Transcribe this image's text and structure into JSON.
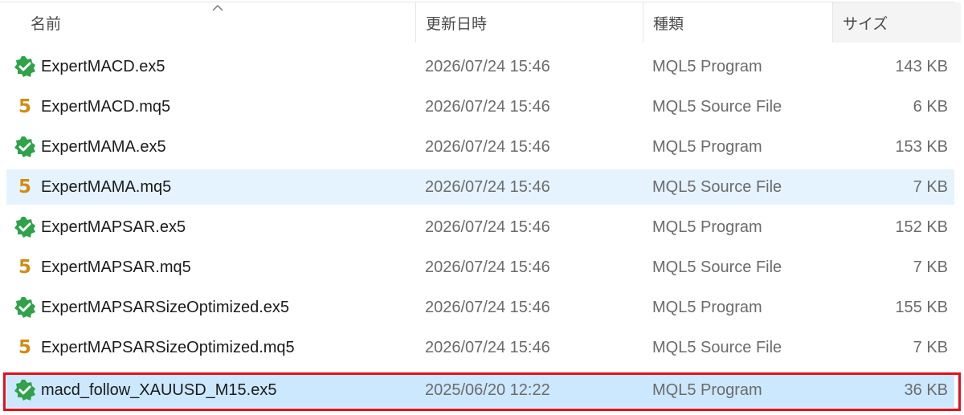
{
  "columns": {
    "name": "名前",
    "date": "更新日時",
    "type": "種類",
    "size": "サイズ"
  },
  "files": [
    {
      "name": "ExpertMACD.ex5",
      "date": "2026/07/24 15:46",
      "type": "MQL5 Program",
      "size": "143 KB",
      "icon": "mql5-program-icon"
    },
    {
      "name": "ExpertMACD.mq5",
      "date": "2026/07/24 15:46",
      "type": "MQL5 Source File",
      "size": "6 KB",
      "icon": "mql5-source-icon"
    },
    {
      "name": "ExpertMAMA.ex5",
      "date": "2026/07/24 15:46",
      "type": "MQL5 Program",
      "size": "153 KB",
      "icon": "mql5-program-icon"
    },
    {
      "name": "ExpertMAMA.mq5",
      "date": "2026/07/24 15:46",
      "type": "MQL5 Source File",
      "size": "7 KB",
      "icon": "mql5-source-icon"
    },
    {
      "name": "ExpertMAPSAR.ex5",
      "date": "2026/07/24 15:46",
      "type": "MQL5 Program",
      "size": "152 KB",
      "icon": "mql5-program-icon"
    },
    {
      "name": "ExpertMAPSAR.mq5",
      "date": "2026/07/24 15:46",
      "type": "MQL5 Source File",
      "size": "7 KB",
      "icon": "mql5-source-icon"
    },
    {
      "name": "ExpertMAPSARSizeOptimized.ex5",
      "date": "2026/07/24 15:46",
      "type": "MQL5 Program",
      "size": "155 KB",
      "icon": "mql5-program-icon"
    },
    {
      "name": "ExpertMAPSARSizeOptimized.mq5",
      "date": "2026/07/24 15:46",
      "type": "MQL5 Source File",
      "size": "7 KB",
      "icon": "mql5-source-icon"
    },
    {
      "name": "macd_follow_XAUUSD_M15.ex5",
      "date": "2025/06/20 12:22",
      "type": "MQL5 Program",
      "size": "36 KB",
      "icon": "mql5-program-icon"
    }
  ],
  "source_icon_glyph": "5",
  "colors": {
    "hover_row": "#e5f3ff",
    "selected_row": "#cce8ff",
    "highlight_border": "#e0101c",
    "program_icon": "#2fa24a",
    "source_icon": "#d18c13"
  }
}
